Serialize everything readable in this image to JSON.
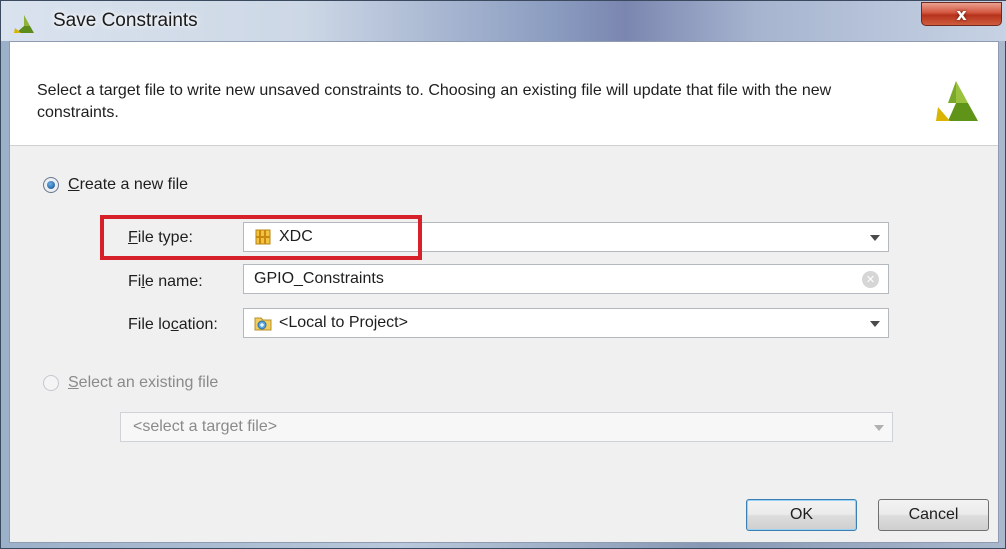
{
  "window": {
    "title": "Save Constraints",
    "close_glyph": "x"
  },
  "header": {
    "description": "Select a target file to write new unsaved constraints to. Choosing an existing file will update that file with the new constraints."
  },
  "create_option": {
    "label_mnemonic": "C",
    "label_rest": "reate a new file",
    "selected": true
  },
  "fields": {
    "file_type": {
      "label_mnemonic": "F",
      "label_rest": "ile type:",
      "value": "XDC",
      "icon": "xdc-file-icon"
    },
    "file_name": {
      "label_pre": "Fi",
      "label_mnemonic": "l",
      "label_rest": "e name:",
      "value": "GPIO_Constraints",
      "clear_icon": "clear-icon"
    },
    "file_location": {
      "label_pre": "File lo",
      "label_mnemonic": "c",
      "label_rest": "ation:",
      "value": "<Local to Project>",
      "icon": "folder-icon"
    }
  },
  "existing_option": {
    "label_mnemonic": "S",
    "label_rest": "elect an existing file",
    "selected": false,
    "enabled": false,
    "target_placeholder": "<select a target file>"
  },
  "buttons": {
    "ok": "OK",
    "cancel": "Cancel"
  },
  "colors": {
    "highlight": "#d6202a",
    "logo_green": "#6a9a1f",
    "logo_yellow": "#d9b400"
  }
}
